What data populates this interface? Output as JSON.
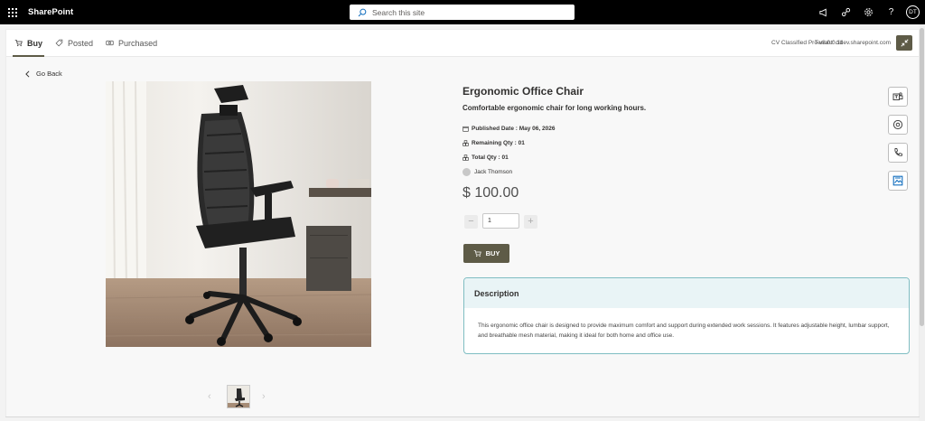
{
  "suitebar": {
    "brand": "SharePoint",
    "search_placeholder": "Search this site",
    "icons": [
      "megaphone-icon",
      "share-icon",
      "settings-icon",
      "help-icon"
    ],
    "avatar_initials": "DT"
  },
  "tabs": [
    {
      "label": "Buy",
      "icon": "cart-icon",
      "active": true
    },
    {
      "label": "Posted",
      "icon": "tag-icon",
      "active": false
    },
    {
      "label": "Purchased",
      "icon": "money-icon",
      "active": false
    }
  ],
  "header": {
    "version": "CV Classified Pro v8.0.0.11",
    "tenant": "Tenant: cidev.sharepoint.com"
  },
  "nav": {
    "go_back": "Go Back"
  },
  "product": {
    "title": "Ergonomic Office Chair",
    "subtitle": "Comfortable ergonomic chair for long working hours.",
    "published_date": "Published Date : May 06, 2026",
    "remaining_qty": "Remaining Qty : 01",
    "total_qty": "Total Qty : 01",
    "seller": "Jack Thomson",
    "price": "$ 100.00",
    "quantity": "1",
    "buy_label": "BUY"
  },
  "description": {
    "heading": "Description",
    "text": "This ergonomic office chair is designed to provide maximum comfort and support during extended work sessions. It features adjustable height, lumbar support, and breathable mesh material, making it ideal for both home and office use."
  },
  "side_actions": [
    "teams-icon",
    "mail-icon",
    "phone-icon",
    "image-icon"
  ],
  "colors": {
    "accent": "#5e5b47",
    "description_border": "#7fbdc2",
    "description_header": "#e9f4f6"
  }
}
